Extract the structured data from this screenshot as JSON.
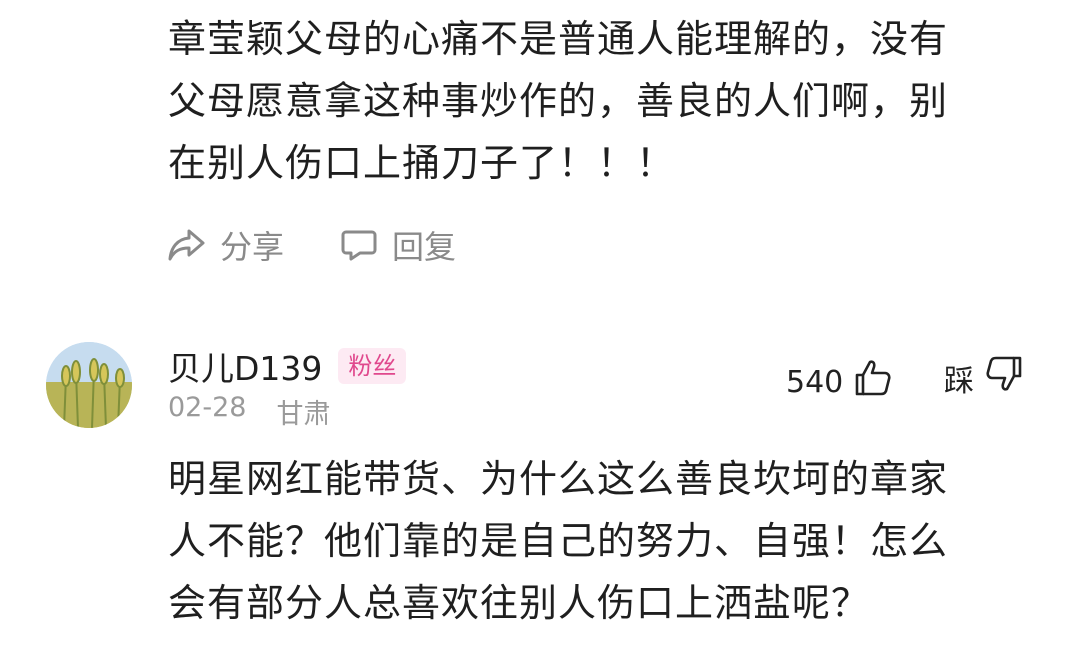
{
  "previous_comment": {
    "lines": [
      "章莹颖父母的心痛不是普通人能理解的，没有",
      "父母愿意拿这种事炒作的，善良的人们啊，别",
      "在别人伤口上捅刀子了！！！"
    ],
    "actions": {
      "share_label": "分享",
      "reply_label": "回复"
    }
  },
  "comment": {
    "author": "贝儿D139",
    "badge": "粉丝",
    "date": "02-28",
    "location": "甘肃",
    "like_count": "540",
    "dislike_label": "踩",
    "lines": [
      "明星网红能带货、为什么这么善良坎坷的章家",
      "人不能？他们靠的是自己的努力、自强！怎么",
      "会有部分人总喜欢往别人伤口上洒盐呢？"
    ]
  },
  "icons": {
    "share": "share-icon",
    "reply": "comment-bubble-icon",
    "like": "thumbs-up-icon",
    "dislike": "thumbs-down-icon"
  },
  "colors": {
    "badge_bg": "#fdeaf3",
    "badge_text": "#e0488d",
    "muted": "#8a8a8a"
  }
}
